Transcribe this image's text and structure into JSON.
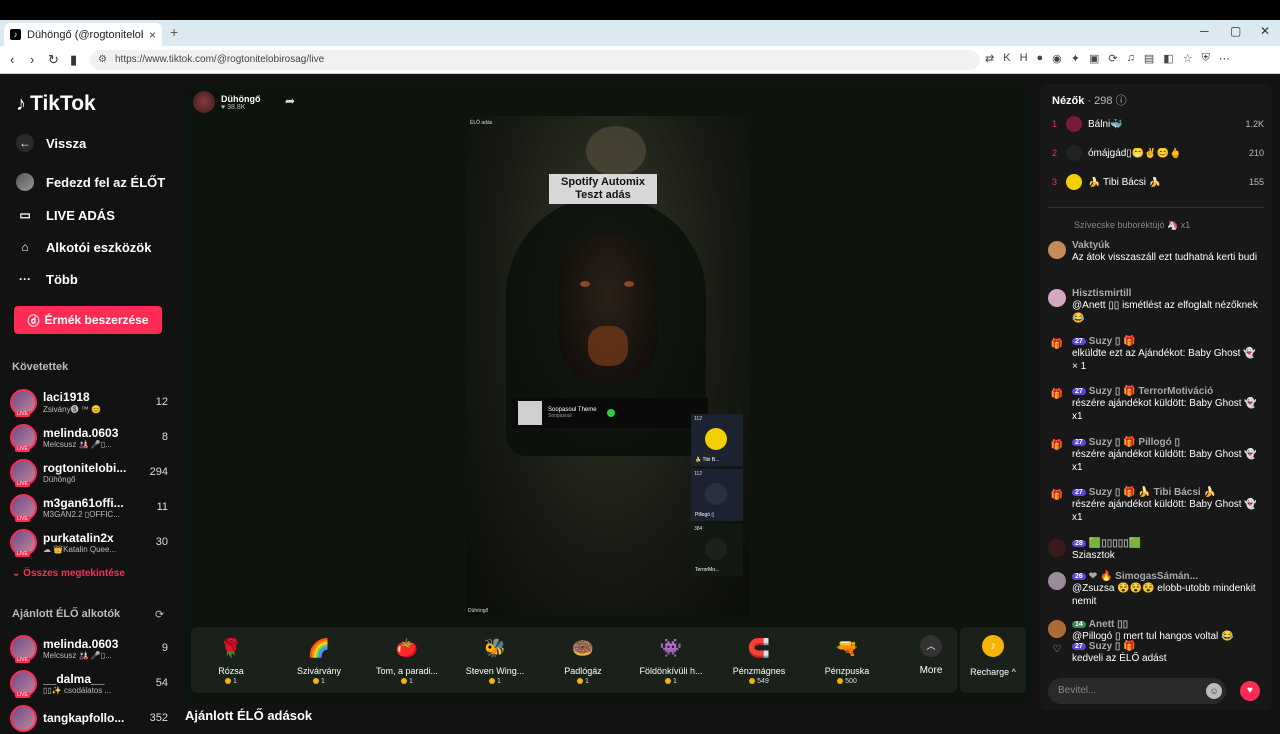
{
  "browser": {
    "tab_title": "Dühöngő (@rogtonitelobiros…",
    "tab_close": "×",
    "new_tab": "+",
    "url": "https://www.tiktok.com/@rogtonitelobirosag/live",
    "controls": [
      "─",
      "▢",
      "✕"
    ]
  },
  "nav": {
    "logo": "TikTok",
    "items": [
      {
        "label": "Vissza",
        "icon": "back-arrow-icon"
      },
      {
        "label": "Fedezd fel az ÉLŐT",
        "icon": "explore-live-icon"
      },
      {
        "label": "LIVE ADÁS",
        "icon": "live-camera-icon"
      },
      {
        "label": "Alkotói eszközök",
        "icon": "creator-tools-icon"
      },
      {
        "label": "Több",
        "icon": "more-dots-icon"
      }
    ],
    "coins_button": "Érmék beszerzése",
    "following_title": "Követettek",
    "following": [
      {
        "name": "laci1918",
        "sub": "Zsivány🅢 ™ 😊",
        "count": "12"
      },
      {
        "name": "melinda.0603",
        "sub": "Melcsusz 🎎 🎤▯...",
        "count": "8"
      },
      {
        "name": "rogtonitelobi...",
        "sub": "Dühöngő",
        "count": "294"
      },
      {
        "name": "m3gan61offi...",
        "sub": "M3GAN2.2 ▯OFFIC...",
        "count": "11"
      },
      {
        "name": "purkatalin2x",
        "sub": "☁ 👑Katalin Quee...",
        "count": "30"
      }
    ],
    "see_all": "Összes megtekintése",
    "recommended_title": "Ajánlott ÉLŐ alkotók",
    "recommended": [
      {
        "name": "melinda.0603",
        "sub": "Melcsusz 🎎 🎤▯...",
        "count": "9"
      },
      {
        "name": "__dalma__",
        "sub": "▯▯✨ csodálatos ...",
        "count": "54"
      },
      {
        "name": "tangkapfollo...",
        "sub": "",
        "count": "352"
      }
    ]
  },
  "stream": {
    "host_name": "Dühöngő",
    "host_likes": "♥ 38.8K",
    "overlay_top": "ÉLŐ adás",
    "overlay_bottom": "Dühöngő",
    "spotify_title": "Spotify Automix",
    "spotify_sub": "Teszt adás",
    "now_playing_title": "Soopasoul Theme",
    "now_playing_artist": "Soopasoul",
    "participants": [
      {
        "score": "112",
        "name": "🍌 Tibi B..."
      },
      {
        "score": "112",
        "name": "Pillogó ▯"
      },
      {
        "score": "384",
        "name": "TerrorMo..."
      }
    ]
  },
  "gifts": [
    {
      "name": "Rózsa",
      "price": "1",
      "icon": "🌹"
    },
    {
      "name": "Szivárvány",
      "price": "1",
      "icon": "🌈"
    },
    {
      "name": "Tom, a paradi...",
      "price": "1",
      "icon": "🍅"
    },
    {
      "name": "Steven Wing...",
      "price": "1",
      "icon": "🐝"
    },
    {
      "name": "Padlógáz",
      "price": "1",
      "icon": "🍩"
    },
    {
      "name": "Földönkívüli h...",
      "price": "1",
      "icon": "👾"
    },
    {
      "name": "Pénzmágnes",
      "price": "549",
      "icon": "🧲"
    },
    {
      "name": "Pénzpuska",
      "price": "500",
      "icon": "🔫"
    }
  ],
  "more_label": "More",
  "recharge_label": "Recharge ^",
  "recommended_live": "Ajánlott ÉLŐ adások",
  "viewers": {
    "title": "Nézők",
    "count": " · 298 ⓘ",
    "top": [
      {
        "rank": "1",
        "name": "Bálni🐳",
        "score": "1.2K"
      },
      {
        "rank": "2",
        "name": "ómájgád▯😁✌😊🖕",
        "score": "210"
      },
      {
        "rank": "3",
        "name": "🍌 Tibi Bácsi 🍌",
        "score": "155"
      }
    ]
  },
  "chat": {
    "top_line": "Szívecske buboréktújó 🦄 x1",
    "messages": [
      {
        "user": "Vaktyúk",
        "text": "Az átok visszaszáll ezt tudhatná kerti budi"
      },
      {
        "user": "Hisztismirtill",
        "text": "@Anett ▯▯ ismétlést az elfoglalt nézőknek 😂"
      },
      {
        "user": "Suzy ▯ 🎁",
        "text": "elküldte ezt az Ajándékot: Baby Ghost 👻 × 1",
        "lvl": "27"
      },
      {
        "user": "Suzy ▯ 🎁 TerrorMotiváció",
        "text": "részére ajándékot küldött: Baby Ghost 👻 x1",
        "lvl": "27"
      },
      {
        "user": "Suzy ▯ 🎁 Pillogó ▯",
        "text": "részére ajándékot küldött: Baby Ghost 👻 x1",
        "lvl": "27"
      },
      {
        "user": "Suzy ▯ 🎁 🍌 Tibi Bácsi 🍌",
        "text": "részére ajándékot küldött: Baby Ghost 👻 x1",
        "lvl": "27"
      },
      {
        "user": "🟩▯▯▯▯▯🟩",
        "text": "Sziasztok",
        "lvl": "28"
      },
      {
        "user": "❤ 🔥 SimogasSámán...",
        "text": "@Zsuzsa 😵😵😵 elobb-utobb mindenkit nemit",
        "lvl": "26"
      },
      {
        "user": "Anett ▯▯",
        "text": "@Pillogó ▯ mert tul hangos voltal 😂",
        "lvl": "14"
      },
      {
        "user": "Suzy ▯ 🎁",
        "text": "kedveli az ÉLŐ adást",
        "lvl": "27"
      }
    ],
    "input_placeholder": "Bevitel..."
  }
}
